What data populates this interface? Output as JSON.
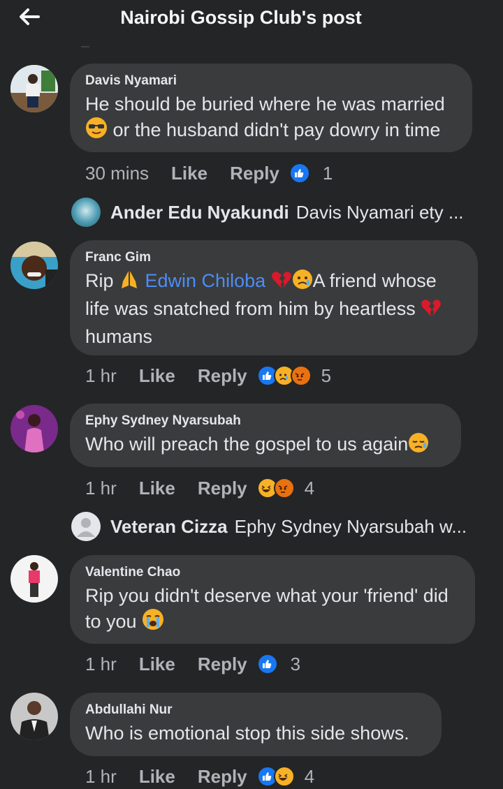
{
  "header": {
    "title": "Nairobi Gossip Club's post"
  },
  "comments": [
    {
      "author": "Davis Nyamari",
      "text_line1": "He should be buried where he was married",
      "text_line2": " or the husband didn't pay dowry in time",
      "time": "30 mins",
      "like": "Like",
      "reply": "Reply",
      "reaction_count": "1",
      "reactions": [
        "like"
      ]
    },
    {
      "author": "Franc Gim",
      "text_rip": "Rip ",
      "mention": " Edwin Chiloba",
      "text_after_mention": "A friend whose",
      "text_line2": "life was snatched from him by heartless ",
      "text_line3": "humans",
      "time": "1 hr",
      "like": "Like",
      "reply": "Reply",
      "reaction_count": "5",
      "reactions": [
        "like",
        "sad",
        "angry"
      ]
    },
    {
      "author": "Ephy Sydney Nyarsubah",
      "text_line1": "Who will preach the gospel to us again",
      "time": "1 hr",
      "like": "Like",
      "reply": "Reply",
      "reaction_count": "4",
      "reactions": [
        "haha",
        "angry"
      ]
    },
    {
      "author": "Valentine Chao",
      "text_line1": "Rip you didn't deserve what your 'friend' did",
      "text_line2": "to you ",
      "time": "1 hr",
      "like": "Like",
      "reply": "Reply",
      "reaction_count": "3",
      "reactions": [
        "like"
      ]
    },
    {
      "author": "Abdullahi Nur",
      "text_line1": "Who is emotional stop this side shows.",
      "time": "1 hr",
      "like": "Like",
      "reply": "Reply",
      "reaction_count": "4",
      "reactions": [
        "like",
        "haha"
      ]
    }
  ],
  "reply_previews": [
    {
      "name": "Ander Edu Nyakundi",
      "text": "Davis Nyamari ety ..."
    },
    {
      "name": "Veteran Cizza",
      "text": "Ephy Sydney Nyarsubah w..."
    }
  ],
  "colors": {
    "background": "#242526",
    "bubble": "#3a3b3c",
    "mention": "#4c8df6",
    "like_blue": "#1877f2",
    "react_yellow": "#f7b125",
    "react_angry": "#e9710f"
  }
}
